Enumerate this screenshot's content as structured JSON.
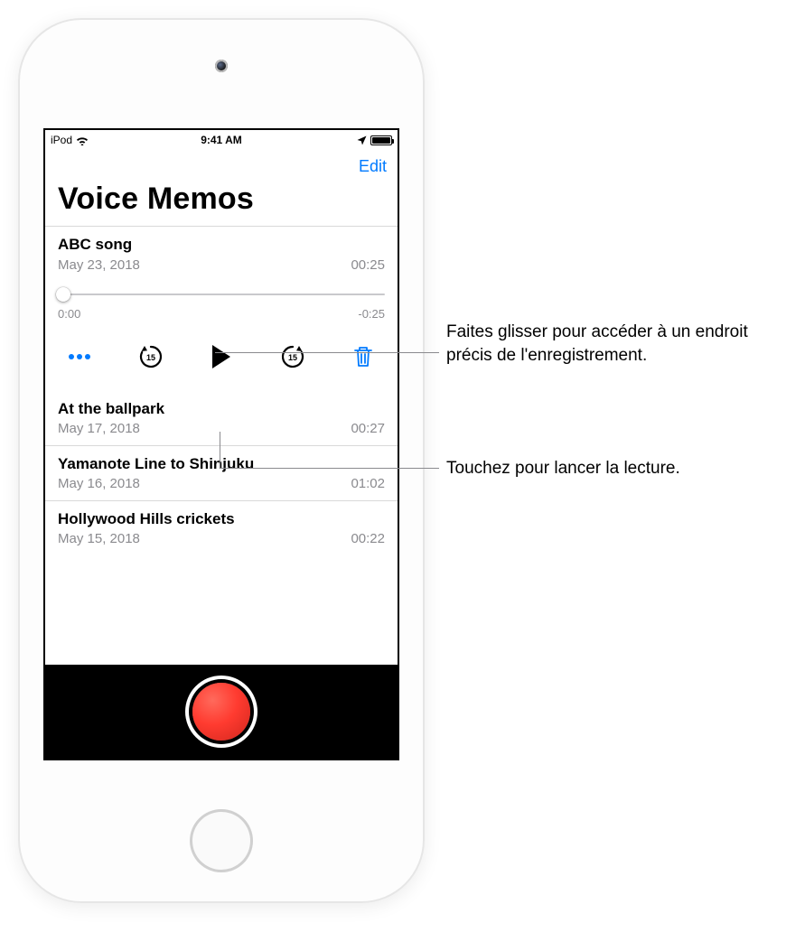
{
  "status": {
    "carrier": "iPod",
    "time": "9:41 AM"
  },
  "nav": {
    "edit": "Edit"
  },
  "title": "Voice Memos",
  "expanded": {
    "title": "ABC song",
    "date": "May 23, 2018",
    "duration": "00:25",
    "elapsed": "0:00",
    "remaining": "-0:25"
  },
  "memos": [
    {
      "title": "At the ballpark",
      "date": "May 17, 2018",
      "duration": "00:27"
    },
    {
      "title": "Yamanote Line to Shinjuku",
      "date": "May 16, 2018",
      "duration": "01:02"
    },
    {
      "title": "Hollywood Hills crickets",
      "date": "May 15, 2018",
      "duration": "00:22"
    }
  ],
  "callouts": {
    "scrubber": "Faites glisser pour accéder à un endroit précis de l'enregistrement.",
    "play": "Touchez pour lancer la lecture."
  }
}
